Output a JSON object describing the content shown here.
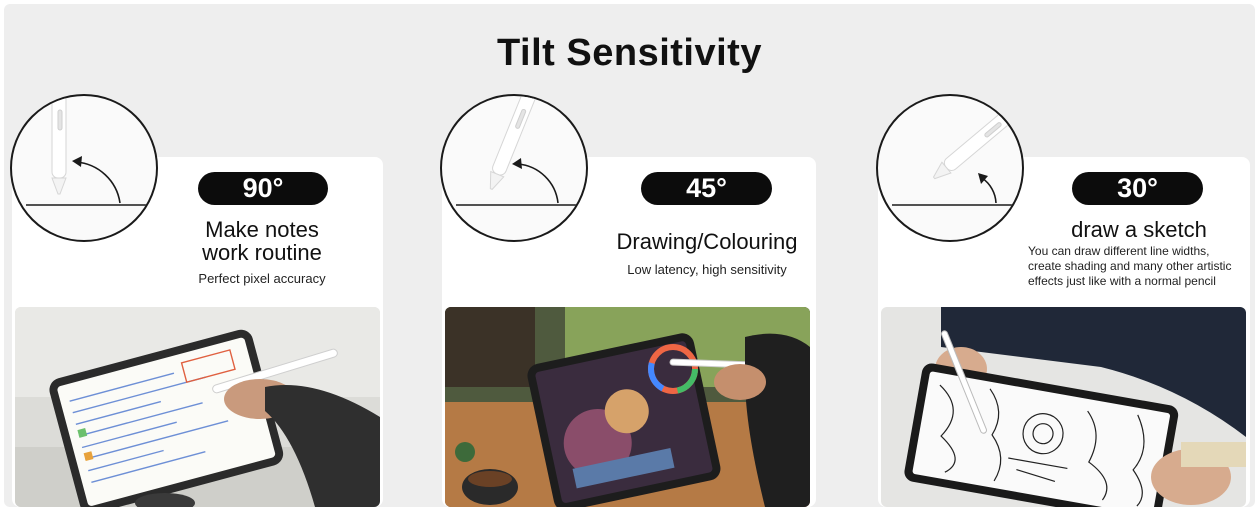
{
  "title": "Tilt Sensitivity",
  "panels": [
    {
      "angle": "90°",
      "heading_line1": "Make notes",
      "heading_line2": "work routine",
      "subtitle": "Perfect pixel accuracy"
    },
    {
      "angle": "45°",
      "heading_line1": "Drawing/Colouring",
      "subtitle": "Low latency, high sensitivity"
    },
    {
      "angle": "30°",
      "heading_line1": "draw a sketch",
      "subtitle_line1": "You can draw different line widths,",
      "subtitle_line2": "create shading and many other artistic",
      "subtitle_line3": "effects just like with a normal pencil"
    }
  ],
  "colors": {
    "background": "#eeeeee",
    "card": "#ffffff",
    "pill": "#0c0c0c",
    "pill_text": "#ffffff"
  },
  "icons": [
    "stylus-icon",
    "angle-arrow-icon"
  ]
}
